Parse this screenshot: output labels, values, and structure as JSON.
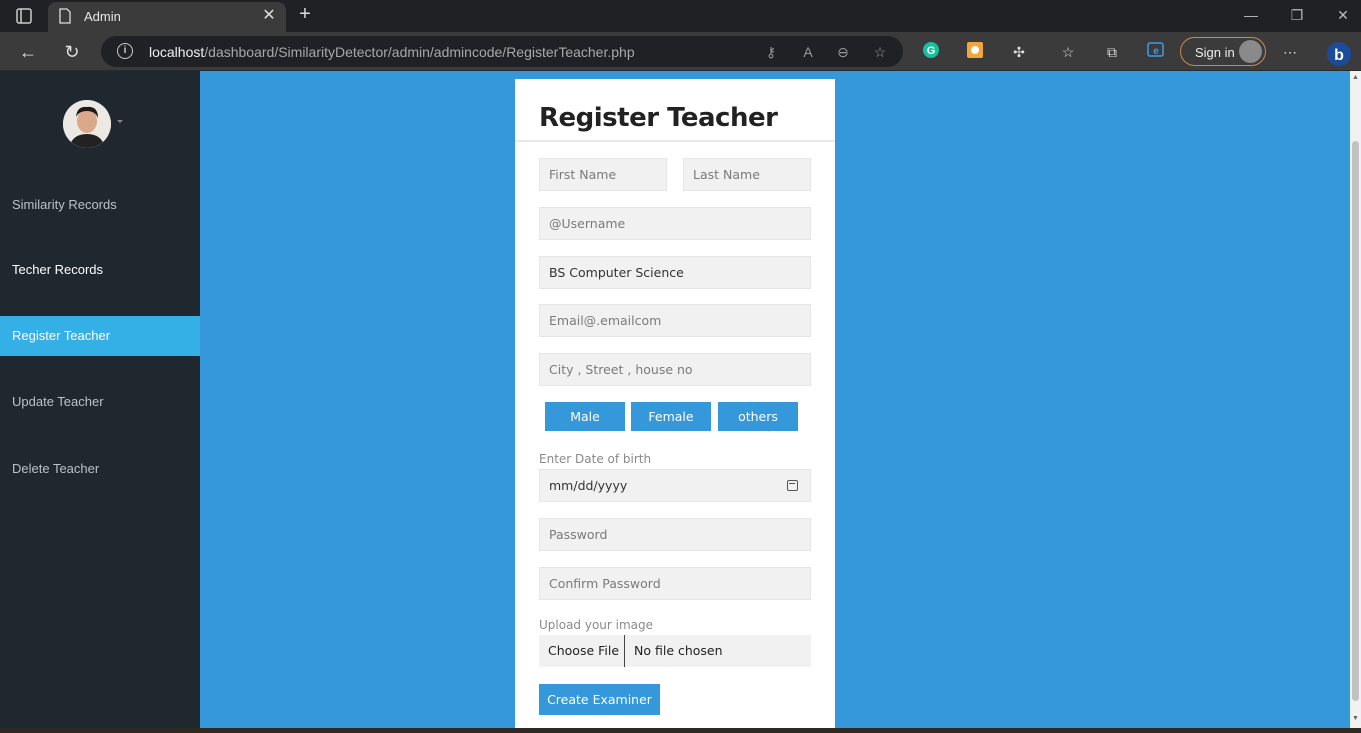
{
  "browser": {
    "tab_title": "Admin",
    "new_tab": "+",
    "url_host": "localhost",
    "url_path": "/dashboard/SimilarityDetector/admin/admincode/RegisterTeacher.php",
    "sign_in": "Sign in"
  },
  "sidebar": {
    "items": [
      {
        "label": "Similarity Records"
      },
      {
        "label": "Techer Records"
      },
      {
        "label": "Register Teacher"
      },
      {
        "label": "Update Teacher"
      },
      {
        "label": "Delete Teacher"
      }
    ]
  },
  "form": {
    "title": "Register Teacher",
    "first_name_placeholder": "First Name",
    "last_name_placeholder": "Last Name",
    "username_placeholder": "@Username",
    "department_value": "BS Computer Science",
    "email_placeholder": "Email@.emailcom",
    "address_placeholder": "City , Street , house no",
    "gender_buttons": [
      "Male",
      "Female",
      "others"
    ],
    "dob_label": "Enter Date of birth",
    "dob_placeholder": "mm/dd/yyyy",
    "password_placeholder": "Password",
    "confirm_password_placeholder": "Confirm Password",
    "upload_label": "Upload your image",
    "choose_file_label": "Choose File",
    "file_status": "No file chosen",
    "submit_label": "Create Examiner"
  },
  "colors": {
    "page_bg": "#3498db",
    "sidebar_bg": "#1f272f",
    "active_item": "#35b0e6",
    "button": "#3498db"
  }
}
